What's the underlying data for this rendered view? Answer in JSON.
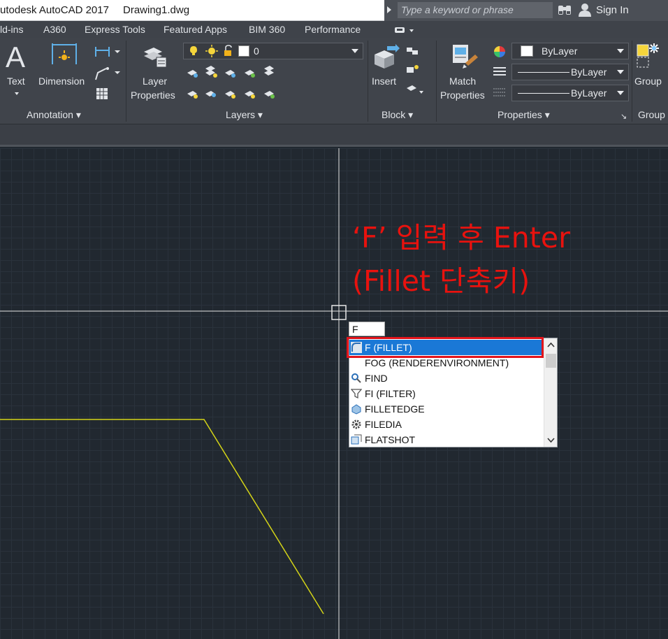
{
  "title_bar": {
    "app_title": "utodesk AutoCAD 2017",
    "file_name": "Drawing1.dwg",
    "search_placeholder": "Type a keyword or phrase",
    "sign_in": "Sign In"
  },
  "ribbon_tabs": [
    "ld-ins",
    "A360",
    "Express Tools",
    "Featured Apps",
    "BIM 360",
    "Performance"
  ],
  "ribbon": {
    "annotation": {
      "text_label": "Text",
      "dimension_label": "Dimension",
      "panel_title": "Annotation ▾"
    },
    "layers": {
      "layer_props_label1": "Layer",
      "layer_props_label2": "Properties",
      "current_layer": "0",
      "panel_title": "Layers ▾"
    },
    "block": {
      "insert_label": "Insert",
      "panel_title": "Block ▾"
    },
    "properties": {
      "match_label1": "Match",
      "match_label2": "Properties",
      "color_value": "ByLayer",
      "linetype_value": "ByLayer",
      "lineweight_value": "ByLayer",
      "panel_title": "Properties ▾"
    },
    "groups": {
      "group_label": "Group",
      "panel_title": "Group"
    }
  },
  "annotation_text": {
    "line1": "‘F’ 입력 후 Enter",
    "line2": "(Fillet 단축키)"
  },
  "command_input": {
    "value": "F"
  },
  "autocomplete": {
    "items": [
      {
        "label": "F (FILLET)",
        "icon": "fillet-icon",
        "selected": true
      },
      {
        "label": "FOG (RENDERENVIRONMENT)",
        "icon": "",
        "selected": false
      },
      {
        "label": "FIND",
        "icon": "find-icon",
        "selected": false
      },
      {
        "label": "FI (FILTER)",
        "icon": "filter-icon",
        "selected": false
      },
      {
        "label": "FILLETEDGE",
        "icon": "filletedge-icon",
        "selected": false
      },
      {
        "label": "FILEDIA",
        "icon": "gear-icon",
        "selected": false
      },
      {
        "label": "FLATSHOT",
        "icon": "flatshot-icon",
        "selected": false
      }
    ]
  },
  "colors": {
    "annotation_red": "#e8120e",
    "selection_blue": "#1a78d6",
    "geometry_yellow": "#d4d418",
    "crosshair": "#e6e6e6"
  }
}
